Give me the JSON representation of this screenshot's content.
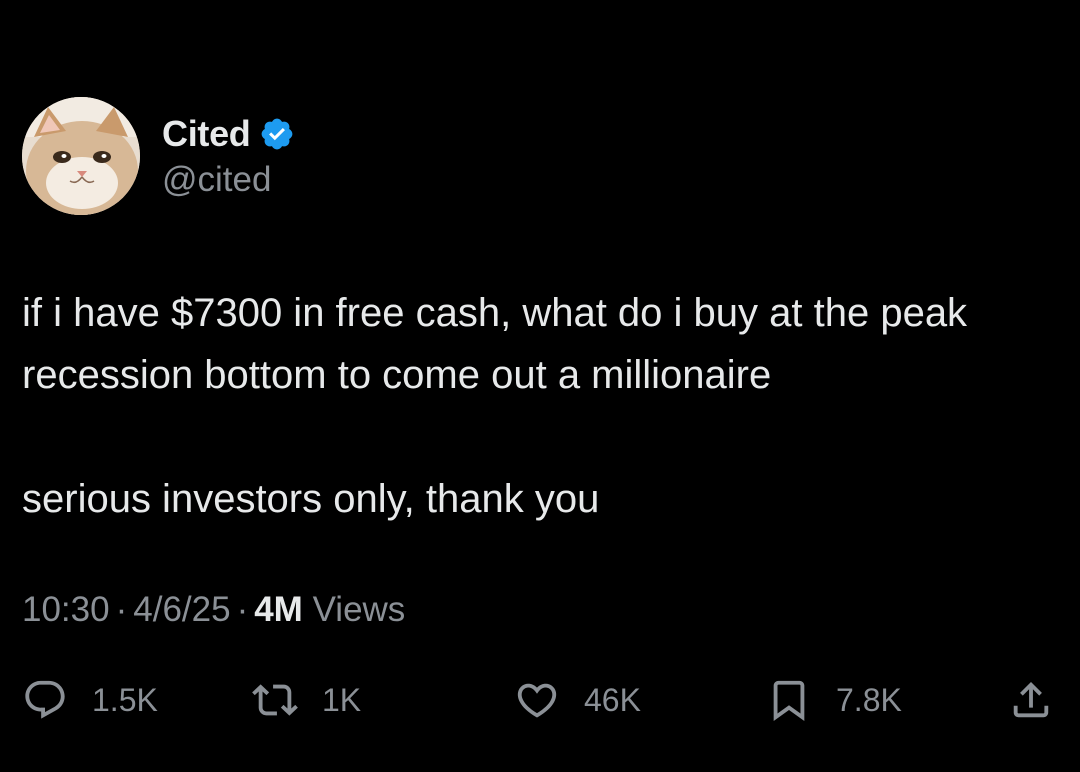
{
  "author": {
    "display_name": "Cited",
    "handle": "@cited",
    "verified": true,
    "verified_color": "#1d9bf0"
  },
  "tweet": {
    "paragraphs": [
      "if i have $7300 in free cash, what do i buy at the peak recession bottom to come out a millionaire",
      "serious investors only, thank you"
    ]
  },
  "meta": {
    "time": "10:30",
    "date": "4/6/25",
    "views_count": "4M",
    "views_label": "Views"
  },
  "actions": {
    "reply": {
      "icon": "reply-icon",
      "count": "1.5K"
    },
    "retweet": {
      "icon": "retweet-icon",
      "count": "1K"
    },
    "like": {
      "icon": "heart-icon",
      "count": "46K"
    },
    "bookmark": {
      "icon": "bookmark-icon",
      "count": "7.8K"
    },
    "share": {
      "icon": "share-icon"
    }
  },
  "colors": {
    "background": "#000000",
    "text": "#e7e9ea",
    "muted": "#8b9096"
  }
}
